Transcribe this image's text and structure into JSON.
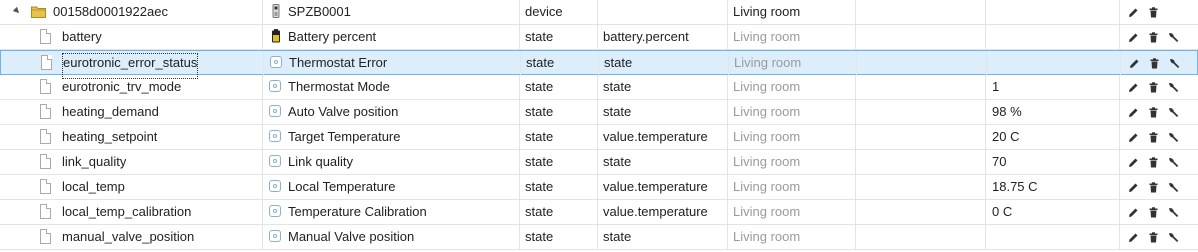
{
  "root": {
    "id": "00158d0001922aec",
    "name": "SPZB0001",
    "type": "device",
    "room": "Living room"
  },
  "rows": [
    {
      "id": "battery",
      "name": "Battery percent",
      "type": "state",
      "role": "battery.percent",
      "room": "Living room",
      "value": "",
      "icon": "battery-icon"
    },
    {
      "id": "eurotronic_error_status",
      "name": "Thermostat Error",
      "type": "state",
      "role": "state",
      "room": "Living room",
      "value": "",
      "icon": "state-icon",
      "selected": true
    },
    {
      "id": "eurotronic_trv_mode",
      "name": "Thermostat Mode",
      "type": "state",
      "role": "state",
      "room": "Living room",
      "value": "1",
      "icon": "state-icon"
    },
    {
      "id": "heating_demand",
      "name": "Auto Valve position",
      "type": "state",
      "role": "state",
      "room": "Living room",
      "value": "98 %",
      "icon": "state-icon"
    },
    {
      "id": "heating_setpoint",
      "name": "Target Temperature",
      "type": "state",
      "role": "value.temperature",
      "room": "Living room",
      "value": "20 C",
      "icon": "state-icon"
    },
    {
      "id": "link_quality",
      "name": "Link quality",
      "type": "state",
      "role": "state",
      "room": "Living room",
      "value": "70",
      "icon": "state-icon"
    },
    {
      "id": "local_temp",
      "name": "Local Temperature",
      "type": "state",
      "role": "value.temperature",
      "room": "Living room",
      "value": "18.75 C",
      "icon": "state-icon"
    },
    {
      "id": "local_temp_calibration",
      "name": "Temperature Calibration",
      "type": "state",
      "role": "value.temperature",
      "room": "Living room",
      "value": "0 C",
      "icon": "state-icon"
    },
    {
      "id": "manual_valve_position",
      "name": "Manual Valve position",
      "type": "state",
      "role": "state",
      "room": "Living room",
      "value": "",
      "icon": "state-icon"
    }
  ],
  "actions": [
    "edit-icon",
    "delete-icon",
    "wrench-icon"
  ],
  "colors": {
    "selected_bg": "#dceefb",
    "selected_border": "#6fb4e6",
    "room_muted": "#9a9a9a"
  }
}
